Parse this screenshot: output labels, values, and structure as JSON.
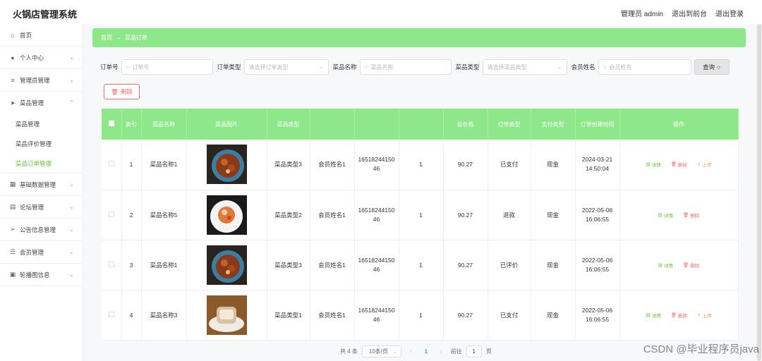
{
  "app": {
    "title": "火锅店管理系统"
  },
  "header": {
    "admin": "管理员 admin",
    "front": "退出到前台",
    "logout": "退出登录"
  },
  "sidebar": {
    "home": "首页",
    "personal": "个人中心",
    "admin_mgmt": "管理员管理",
    "dish_mgmt": "菜品管理",
    "sub_items": [
      "菜品管理",
      "菜品评价管理",
      "菜品订单管理"
    ],
    "base_data": "基础数据管理",
    "forum": "论坛管理",
    "notice": "公告信息管理",
    "member": "会员管理",
    "carousel": "轮播图信息"
  },
  "breadcrumb": {
    "home": "首页",
    "current": "菜品订单"
  },
  "filters": {
    "order_no": {
      "label": "订单号",
      "placeholder": "订单号"
    },
    "order_type": {
      "label": "订单类型",
      "placeholder": "请选择订单类型"
    },
    "dish_name": {
      "label": "菜品名称",
      "placeholder": "菜品名称"
    },
    "dish_type": {
      "label": "菜品类型",
      "placeholder": "请选择菜品类型"
    },
    "member_name": {
      "label": "会员姓名",
      "placeholder": "会员姓名"
    },
    "query_button": "查询"
  },
  "delete_button": "删除",
  "table": {
    "headers": [
      "索引",
      "菜品名称",
      "菜品图片",
      "菜品类型",
      "",
      "",
      "",
      "总价格",
      "订单类型",
      "支付类型",
      "订单创建时间",
      "操作"
    ],
    "rows": [
      {
        "index": "1",
        "name": "菜品名称1",
        "type": "菜品类型3",
        "member": "会员姓名1",
        "order_no": "1651824415046",
        "qty": "1",
        "price": "90.27",
        "status": "已支付",
        "pay": "现金",
        "date": "2024-03-21",
        "time": "14:50:04",
        "actions": [
          "详情",
          "删除",
          "上传"
        ]
      },
      {
        "index": "2",
        "name": "菜品名称5",
        "type": "菜品类型2",
        "member": "会员姓名1",
        "order_no": "1651824415046",
        "qty": "1",
        "price": "90.27",
        "status": "退款",
        "pay": "现金",
        "date": "2022-05-06",
        "time": "16:06:55",
        "actions": [
          "详情",
          "删除"
        ]
      },
      {
        "index": "3",
        "name": "菜品名称1",
        "type": "菜品类型3",
        "member": "会员姓名1",
        "order_no": "1651824415046",
        "qty": "1",
        "price": "90.27",
        "status": "已评价",
        "pay": "现金",
        "date": "2022-05-06",
        "time": "16:06:55",
        "actions": [
          "详情",
          "删除"
        ]
      },
      {
        "index": "4",
        "name": "菜品名称3",
        "type": "菜品类型1",
        "member": "会员姓名1",
        "order_no": "1651824415046",
        "qty": "1",
        "price": "90.27",
        "status": "已支付",
        "pay": "现金",
        "date": "2022-05-06",
        "time": "16:06:55",
        "actions": [
          "详情",
          "删除",
          "上传"
        ]
      }
    ]
  },
  "pagination": {
    "total": "共 4 条",
    "size": "10条/页",
    "current": "1",
    "goto_label": "前往",
    "goto_value": "1",
    "page_unit": "页"
  },
  "watermark": "CSDN @毕业程序员java",
  "colors": {
    "accent": "#8ee88a",
    "active": "#67c23a",
    "danger": "#f56c6c",
    "warning": "#e6a23c"
  }
}
